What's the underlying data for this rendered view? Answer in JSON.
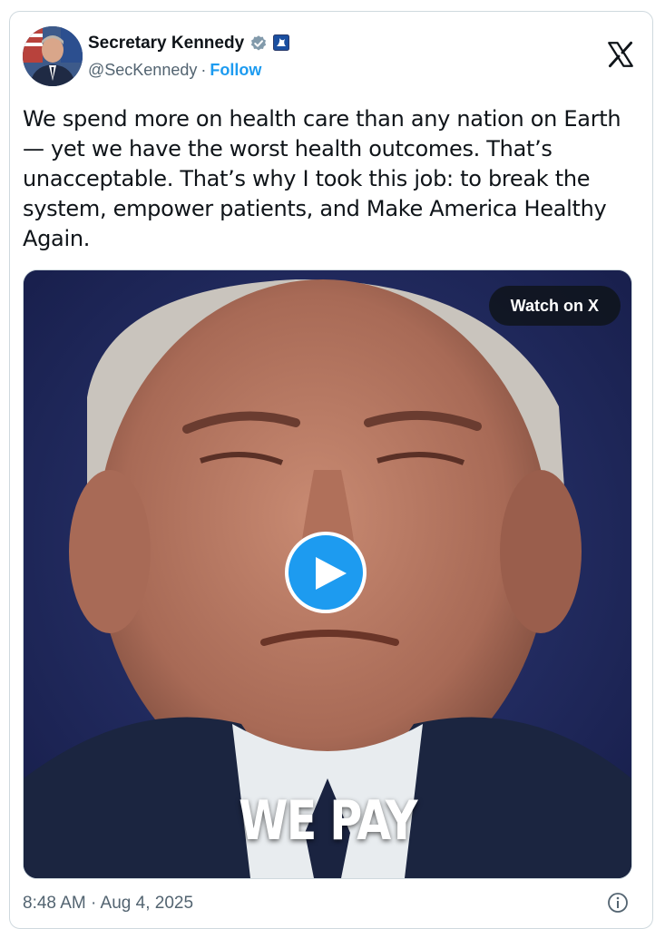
{
  "author": {
    "display_name": "Secretary Kennedy",
    "handle": "@SecKennedy",
    "separator": "·",
    "follow_label": "Follow"
  },
  "tweet": {
    "text": "We spend more on health care than any nation on Earth — yet we have the worst health outcomes. That’s unacceptable. That’s why I took this job: to break the system, empower patients, and Make America Healthy Again.",
    "timestamp": "8:48 AM · Aug 4, 2025"
  },
  "media": {
    "watch_label": "Watch on X",
    "caption": "WE PAY",
    "type": "video"
  },
  "icons": {
    "logo": "x-logo-icon",
    "verified": "verified-badge-icon",
    "affiliate": "affiliate-badge-icon",
    "play": "play-icon",
    "info": "info-icon"
  },
  "colors": {
    "accent": "#1d9bf0",
    "text_primary": "#0f1419",
    "text_secondary": "#536471",
    "border": "#cfd9de",
    "verified_badge": "#829aab"
  }
}
